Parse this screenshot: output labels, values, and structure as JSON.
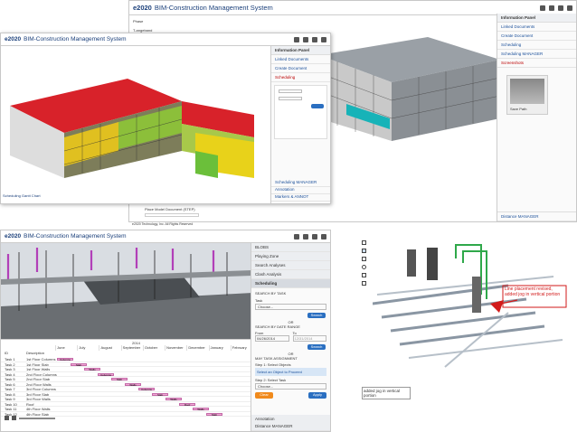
{
  "w1": {
    "logo": "e2020",
    "title": "BIM-Construction Management System",
    "field1": "Phase",
    "field2": "T-angeband",
    "panel_title": "Information Panel",
    "items": [
      "Linked Documents",
      "Create Document",
      "Scheduling",
      "Scheduling MANAGER",
      "Screenshots"
    ],
    "thumb_caption": "Save Path",
    "footer_item": "Distance MANAGER"
  },
  "w2": {
    "logo": "e2020",
    "title": "BIM-Construction Management System",
    "panel_title": "Information Panel",
    "items": [
      "Linked Documents",
      "Create Document",
      "Scheduling"
    ],
    "bottom_label": "Scheduling Gantt Chart",
    "lower_items": [
      "Scheduling MANAGER",
      "Annotation",
      "Markers & ANNOT"
    ],
    "doc_label": "Place Model Document (STEP)",
    "copyright": "e2020 Technology, Inc. All Rights Reserved"
  },
  "w3": {
    "logo": "e2020",
    "title": "BIM-Construction Management System",
    "panel_items": [
      "BLOBS",
      "Playing Zone",
      "Search Analyses",
      "Clash Analysis",
      "Scheduling"
    ],
    "search_by_task": "SEARCH BY TASK",
    "task_label": "Task",
    "choose": "Choose...",
    "search_btn": "Search",
    "or": "OR",
    "search_by_date": "SEARCH BY DATE RANGE",
    "from": "From",
    "to": "To",
    "from_val": "04/26/2014",
    "to_val": "12/31/2014",
    "task_assignment": "MAY TASK ASSIGNMENT",
    "step1": "Step 1: Select Objects",
    "select_prompt": "Select an Object to Proceed",
    "step2": "Step 2: Select Task",
    "clear_btn": "Clear",
    "apply_btn": "Apply",
    "annotation": "Annotation",
    "distance": "Distance MANAGER",
    "year": "2014",
    "months": [
      "June",
      "July",
      "August",
      "September",
      "October",
      "November",
      "December",
      "January",
      "February"
    ],
    "col_id": "ID",
    "col_desc": "Description",
    "tasks": [
      {
        "id": "Task 1",
        "desc": "1st Floor Columns"
      },
      {
        "id": "Task 2",
        "desc": "1st Floor Slab"
      },
      {
        "id": "Task 3",
        "desc": "1st Floor Walls"
      },
      {
        "id": "Task 4",
        "desc": "2nd Floor Columns"
      },
      {
        "id": "Task 5",
        "desc": "2nd Floor Slab"
      },
      {
        "id": "Task 6",
        "desc": "2nd Floor Walls"
      },
      {
        "id": "Task 7",
        "desc": "3rd Floor Columns"
      },
      {
        "id": "Task 8",
        "desc": "3rd Floor Slab"
      },
      {
        "id": "Task 9",
        "desc": "3rd Floor Walls"
      },
      {
        "id": "Task 10",
        "desc": "Roof"
      },
      {
        "id": "Task 11",
        "desc": "4th Floor Walls"
      },
      {
        "id": "Task 12",
        "desc": "4th Floor Slab"
      }
    ],
    "bar_labels": [
      "Columns",
      "Slab",
      "Walls",
      "Columns",
      "Slab",
      "Walls",
      "Columns",
      "Slab",
      "Walls",
      "Roof",
      "Walls",
      "Slab"
    ]
  },
  "w4": {
    "annotation": "Line placement revised, added jog in vertical portion",
    "comment": "added jog in vertical portion"
  }
}
